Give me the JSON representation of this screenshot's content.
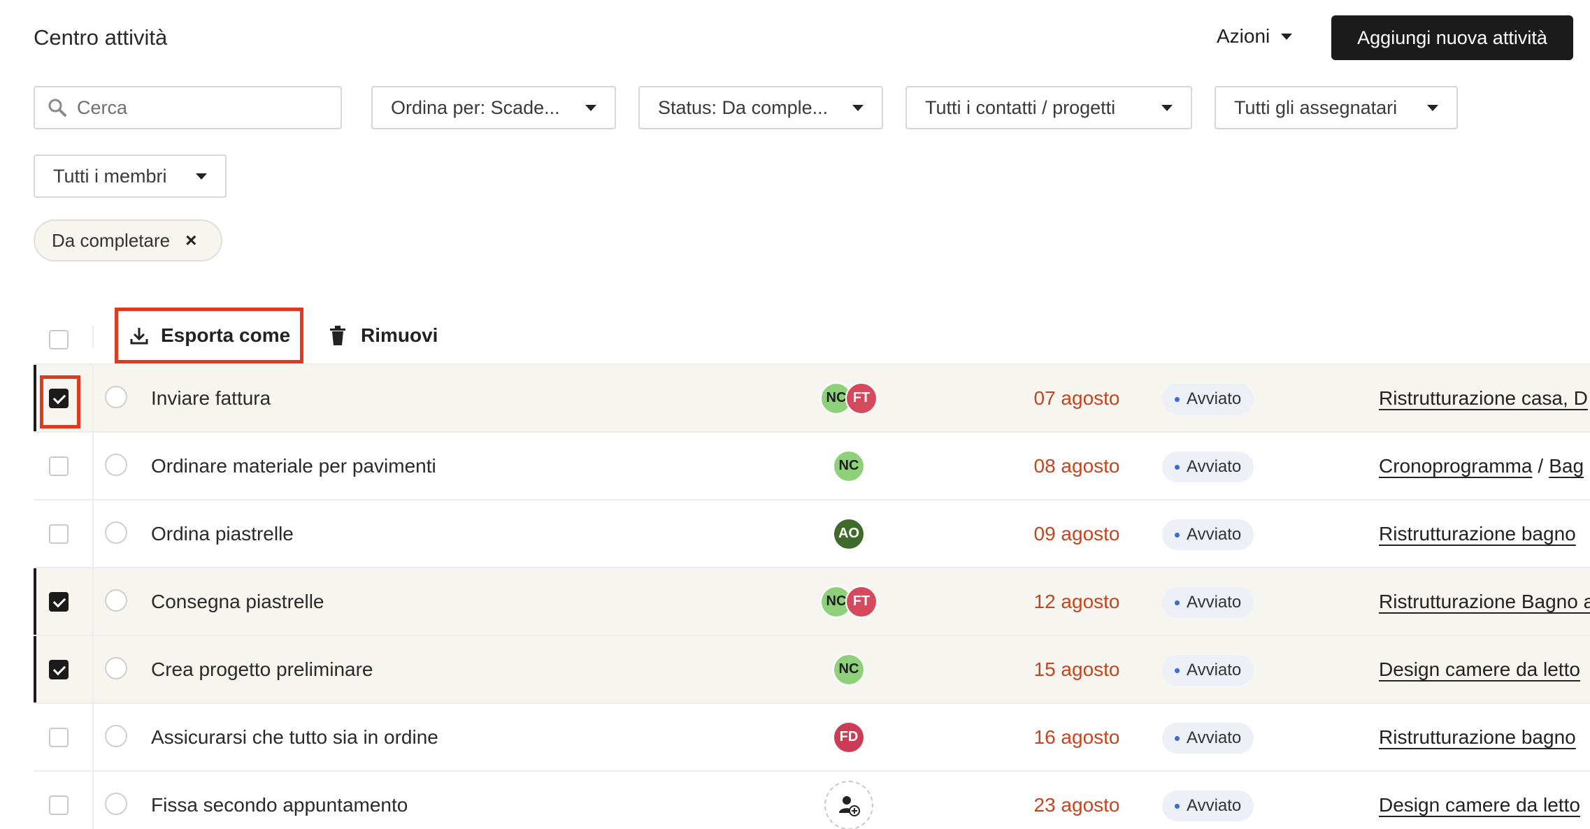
{
  "header": {
    "title": "Centro attività",
    "actions_label": "Azioni",
    "add_button": "Aggiungi nuova attività"
  },
  "filters": {
    "search_placeholder": "Cerca",
    "sort": "Ordina per: Scade...",
    "status": "Status: Da comple...",
    "contacts": "Tutti i contatti / progetti",
    "assignees": "Tutti gli assegnatari",
    "members": "Tutti i membri"
  },
  "active_chip": {
    "label": "Da completare",
    "remove": "×"
  },
  "toolbar": {
    "export_label": "Esporta come",
    "remove_label": "Rimuovi"
  },
  "colors": {
    "accent_dark": "#1b1b1b",
    "highlight": "#e03a1e",
    "date": "#c2461f",
    "status_dot": "#3a6bd8"
  },
  "rows": [
    {
      "checked": true,
      "task": "Inviare fattura",
      "assignees": [
        {
          "initials": "NC",
          "color": "#8fd17a"
        },
        {
          "initials": "FT",
          "color": "#d44a5c"
        }
      ],
      "date": "07 agosto",
      "status": "Avviato",
      "project": [
        "Ristrutturazione casa, D"
      ]
    },
    {
      "checked": false,
      "task": "Ordinare materiale per pavimenti",
      "assignees": [
        {
          "initials": "NC",
          "color": "#8fd17a"
        }
      ],
      "date": "08 agosto",
      "status": "Avviato",
      "project": [
        "Cronoprogramma",
        "Bag"
      ]
    },
    {
      "checked": false,
      "task": "Ordina piastrelle",
      "assignees": [
        {
          "initials": "AO",
          "color": "#3f6b2a"
        }
      ],
      "date": "09 agosto",
      "status": "Avviato",
      "project": [
        "Ristrutturazione bagno"
      ]
    },
    {
      "checked": true,
      "task": "Consegna piastrelle",
      "assignees": [
        {
          "initials": "NC",
          "color": "#8fd17a"
        },
        {
          "initials": "FT",
          "color": "#d44a5c"
        }
      ],
      "date": "12 agosto",
      "status": "Avviato",
      "project": [
        "Ristrutturazione Bagno a"
      ]
    },
    {
      "checked": true,
      "task": "Crea progetto preliminare",
      "assignees": [
        {
          "initials": "NC",
          "color": "#8fd17a"
        }
      ],
      "date": "15 agosto",
      "status": "Avviato",
      "project": [
        "Design camere da letto"
      ]
    },
    {
      "checked": false,
      "task": "Assicurarsi che tutto sia in ordine",
      "assignees": [
        {
          "initials": "FD",
          "color": "#cc3d55"
        }
      ],
      "date": "16 agosto",
      "status": "Avviato",
      "project": [
        "Ristrutturazione bagno"
      ]
    },
    {
      "checked": false,
      "task": "Fissa secondo appuntamento",
      "assignees": [],
      "date": "23 agosto",
      "status": "Avviato",
      "project": [
        "Design camere da letto"
      ]
    }
  ]
}
